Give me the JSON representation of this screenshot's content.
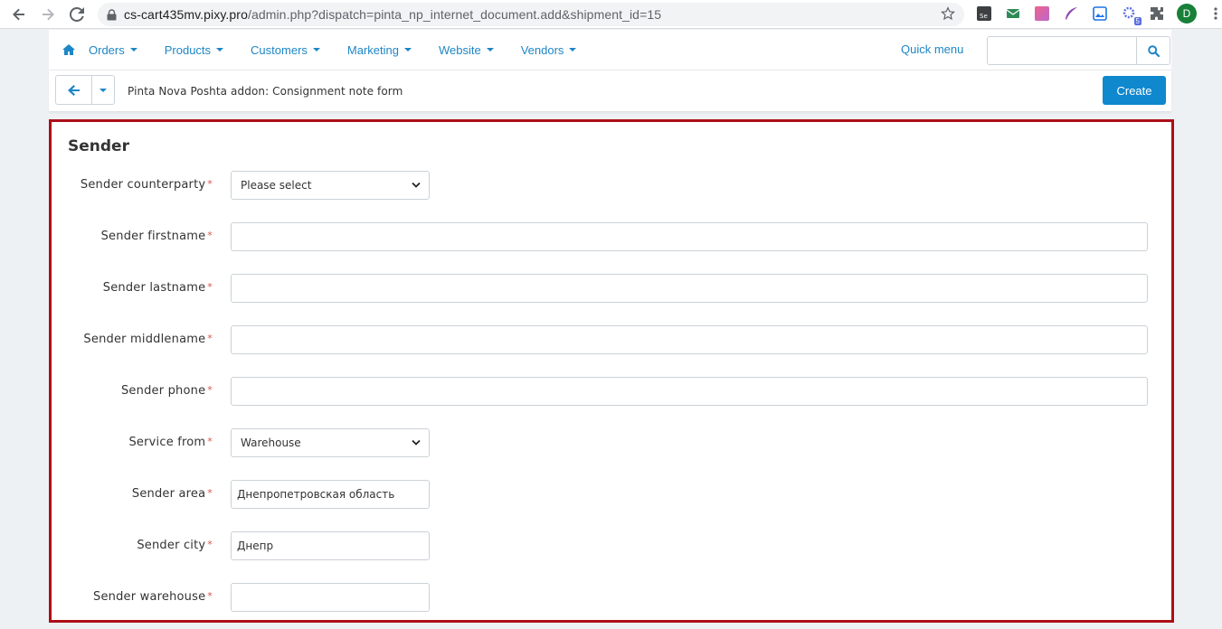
{
  "browser": {
    "url_host": "cs-cart435mv.pixy.pro",
    "url_path": "/admin.php?dispatch=pinta_np_internet_document.add&shipment_id=15",
    "profile_initial": "D",
    "extension_badge": "5",
    "colors": {
      "profile": "#188038",
      "badge": "#5b6ee1"
    }
  },
  "nav": {
    "items": [
      {
        "label": "Orders"
      },
      {
        "label": "Products"
      },
      {
        "label": "Customers"
      },
      {
        "label": "Marketing"
      },
      {
        "label": "Website"
      },
      {
        "label": "Vendors"
      }
    ],
    "quick_menu": "Quick menu",
    "search_value": ""
  },
  "toolbar": {
    "title": "Pinta Nova Poshta addon: Consignment note form",
    "create_label": "Create"
  },
  "form": {
    "section_title": "Sender",
    "required_mark": "*",
    "fields": [
      {
        "label": "Sender counterparty",
        "type": "select",
        "value": "Please select"
      },
      {
        "label": "Sender firstname",
        "type": "text",
        "value": ""
      },
      {
        "label": "Sender lastname",
        "type": "text",
        "value": ""
      },
      {
        "label": "Sender middlename",
        "type": "text",
        "value": ""
      },
      {
        "label": "Sender phone",
        "type": "text",
        "value": ""
      },
      {
        "label": "Service from",
        "type": "select",
        "value": "Warehouse"
      },
      {
        "label": "Sender area",
        "type": "text-short",
        "value": "Днепропетровская область"
      },
      {
        "label": "Sender city",
        "type": "text-short",
        "value": "Днепр"
      },
      {
        "label": "Sender warehouse",
        "type": "text-short",
        "value": ""
      }
    ]
  },
  "colors": {
    "accent": "#1e86c6",
    "primary_button": "#0f88ce",
    "highlight_border": "#ad0e17",
    "required": "#d9534f"
  }
}
